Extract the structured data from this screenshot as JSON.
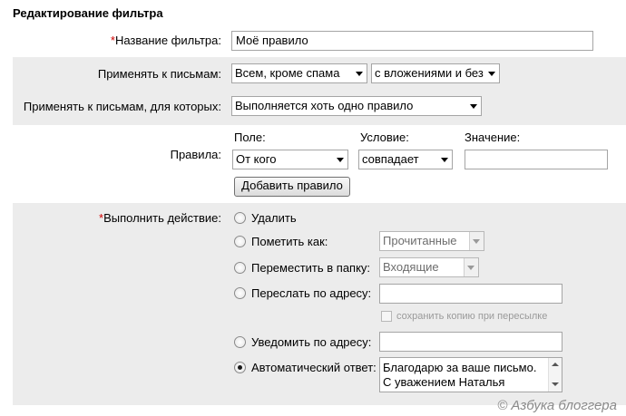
{
  "page": {
    "title": "Редактирование фильтра"
  },
  "filter_name": {
    "label": "Название фильтра:",
    "required_mark": "*",
    "value": "Моё правило"
  },
  "apply_to": {
    "label": "Применять к письмам:",
    "scope_selected": "Всем, кроме спама",
    "attachments_selected": "с вложениями и без"
  },
  "apply_when": {
    "label": "Применять к письмам, для которых:",
    "selected": "Выполняется хоть одно правило"
  },
  "rules": {
    "label": "Правила:",
    "col_field": "Поле:",
    "col_condition": "Условие:",
    "col_value": "Значение:",
    "field_selected": "От кого",
    "condition_selected": "совпадает",
    "value": "",
    "add_button": "Добавить правило"
  },
  "action": {
    "label": "Выполнить действие:",
    "required_mark": "*",
    "selected": "autoreply",
    "delete_label": "Удалить",
    "mark_label": "Пометить как:",
    "mark_select": "Прочитанные",
    "move_label": "Переместить в папку:",
    "move_select": "Входящие",
    "forward_label": "Переслать по адресу:",
    "forward_value": "",
    "save_copy_label": "сохранить копию при пересылке",
    "notify_label": "Уведомить по адресу:",
    "notify_value": "",
    "autoreply_label": "Автоматический ответ:",
    "autoreply_line1": "Благодарю за ваше письмо.",
    "autoreply_line2": "С уважением Наталья"
  },
  "watermark": "© Азбука блоггера"
}
